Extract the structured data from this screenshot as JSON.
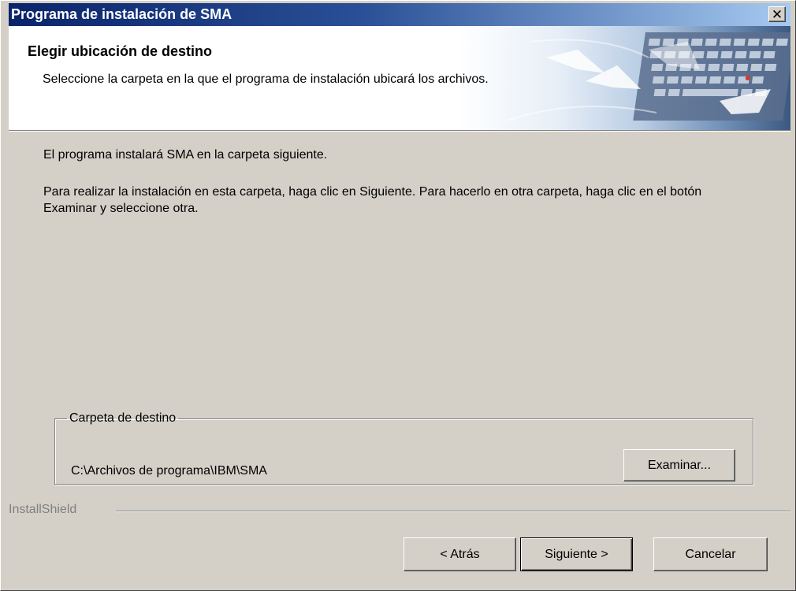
{
  "window": {
    "title": "Programa de instalación de SMA",
    "close_label": "✕"
  },
  "header": {
    "title": "Elegir ubicación de destino",
    "description": "Seleccione la carpeta en la que el programa de instalación ubicará los archivos."
  },
  "body": {
    "text1": "El programa instalará SMA en la carpeta siguiente.",
    "text2": "Para realizar la instalación en esta carpeta, haga clic en Siguiente. Para hacerlo en otra carpeta, haga clic en el botón Examinar y seleccione otra."
  },
  "destination": {
    "legend": "Carpeta de destino",
    "path": "C:\\Archivos de programa\\IBM\\SMA",
    "browse_label": "Examinar..."
  },
  "footer": {
    "brand": "InstallShield",
    "back_label": "< Atrás",
    "next_label": "Siguiente >",
    "cancel_label": "Cancelar"
  },
  "colors": {
    "titlebar_start": "#0a246a",
    "titlebar_end": "#a6caf0",
    "dialog_bg": "#d4d0c8"
  }
}
